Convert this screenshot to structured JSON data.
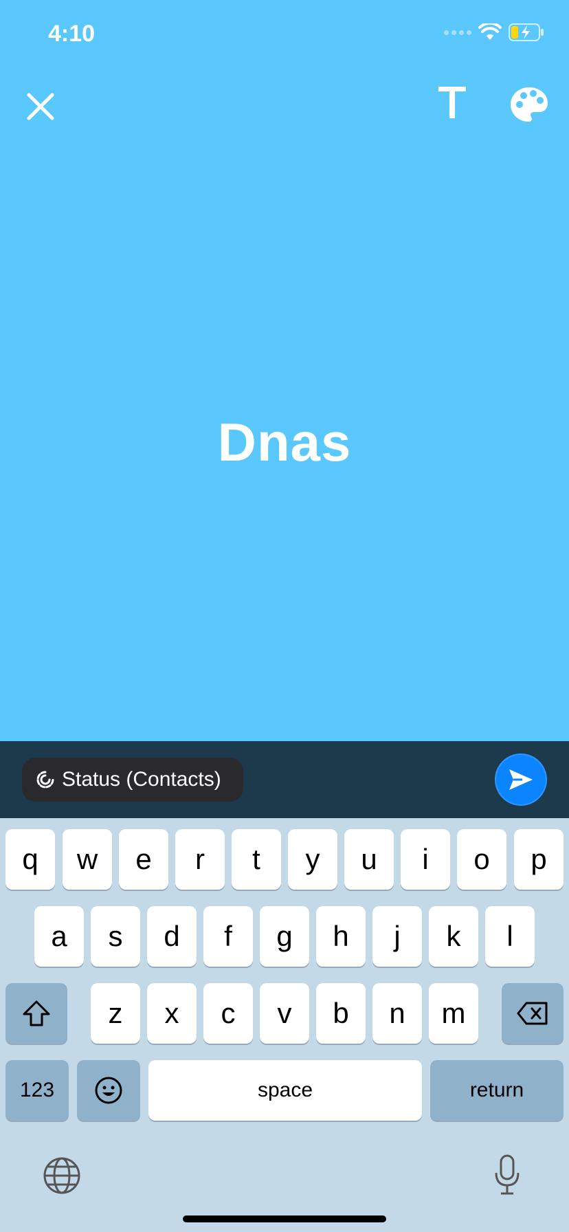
{
  "status_bar": {
    "time": "4:10"
  },
  "toolbar": {
    "close_icon": "close-icon",
    "text_icon": "text-style-icon",
    "palette_icon": "palette-icon"
  },
  "canvas": {
    "text": "Dnas",
    "background_color": "#5AC8FC"
  },
  "composer": {
    "audience_label": "Status (Contacts)",
    "send_icon": "send-icon",
    "bar_color": "#1C3A4B",
    "send_color": "#0A84FF"
  },
  "keyboard": {
    "row1": [
      "q",
      "w",
      "e",
      "r",
      "t",
      "y",
      "u",
      "i",
      "o",
      "p"
    ],
    "row2": [
      "a",
      "s",
      "d",
      "f",
      "g",
      "h",
      "j",
      "k",
      "l"
    ],
    "row3": [
      "z",
      "x",
      "c",
      "v",
      "b",
      "n",
      "m"
    ],
    "numbers_label": "123",
    "space_label": "space",
    "return_label": "return"
  }
}
